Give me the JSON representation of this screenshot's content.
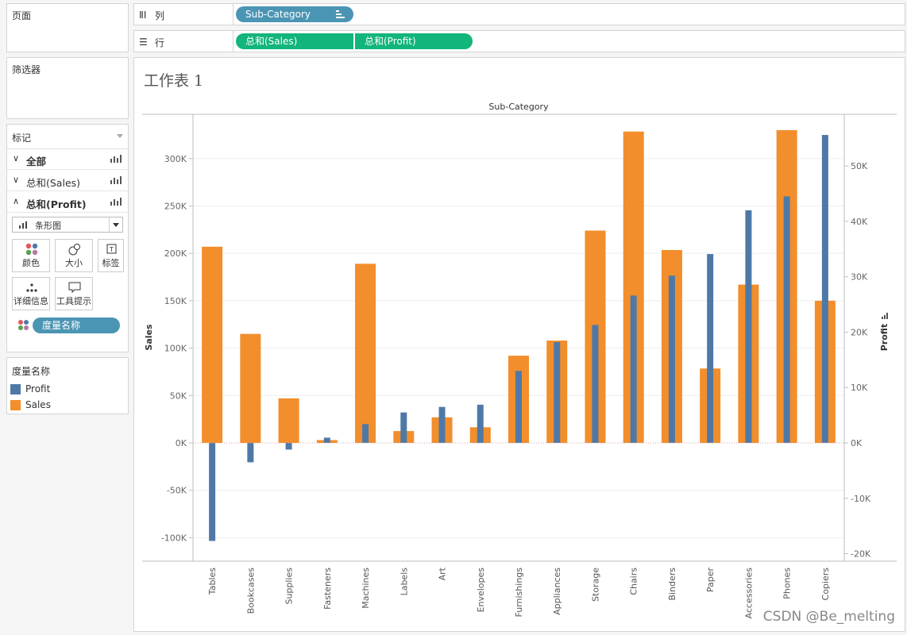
{
  "sidebar": {
    "pages_title": "页面",
    "filters_title": "筛选器",
    "marks": {
      "title": "标记",
      "rows": [
        {
          "label": "全部",
          "state": "collapsed"
        },
        {
          "label": "总和(Sales)",
          "state": "collapsed"
        },
        {
          "label": "总和(Profit)",
          "state": "expanded"
        }
      ],
      "mark_type": "条形图",
      "buttons": {
        "color": "颜色",
        "size": "大小",
        "label": "标签",
        "detail": "详细信息",
        "tooltip": "工具提示"
      },
      "color_pill": "度量名称"
    },
    "legend": {
      "title": "度量名称",
      "items": [
        {
          "name": "Profit",
          "color": "#4e79a7"
        },
        {
          "name": "Sales",
          "color": "#f28e2b"
        }
      ]
    }
  },
  "shelves": {
    "columns": {
      "label": "列",
      "pills": [
        "Sub-Category"
      ]
    },
    "rows": {
      "label": "行",
      "pills": [
        "总和(Sales)",
        "总和(Profit)"
      ]
    }
  },
  "sheet": {
    "title": "工作表 1"
  },
  "chart_data": {
    "type": "bar",
    "title": "Sub-Category",
    "categories": [
      "Tables",
      "Bookcases",
      "Supplies",
      "Fasteners",
      "Machines",
      "Labels",
      "Art",
      "Envelopes",
      "Furnishings",
      "Appliances",
      "Storage",
      "Chairs",
      "Binders",
      "Paper",
      "Accessories",
      "Phones",
      "Copiers"
    ],
    "series": [
      {
        "name": "Sales",
        "axis": "left",
        "color": "#f28e2b",
        "values": [
          207000,
          115000,
          47000,
          3000,
          189000,
          12500,
          27000,
          16500,
          92000,
          108000,
          224000,
          328500,
          203500,
          78500,
          167000,
          330000,
          150000
        ]
      },
      {
        "name": "Profit",
        "axis": "right",
        "color": "#4e79a7",
        "values": [
          -17700,
          -3500,
          -1200,
          950,
          3400,
          5500,
          6500,
          6900,
          13000,
          18200,
          21300,
          26600,
          30200,
          34100,
          42000,
          44500,
          55600
        ]
      }
    ],
    "ylabel": "Sales",
    "y2label": "Profit",
    "ylim": [
      -125000,
      350000
    ],
    "y2lim": [
      -21000,
      58000
    ],
    "yticks": [
      -100000,
      -50000,
      0,
      50000,
      100000,
      150000,
      200000,
      250000,
      300000
    ],
    "ytick_labels": [
      "-100K",
      "-50K",
      "0K",
      "50K",
      "100K",
      "150K",
      "200K",
      "250K",
      "300K"
    ],
    "y2ticks": [
      -20000,
      -10000,
      0,
      10000,
      20000,
      30000,
      40000,
      50000
    ],
    "y2tick_labels": [
      "-20K",
      "-10K",
      "0K",
      "10K",
      "20K",
      "30K",
      "40K",
      "50K"
    ],
    "grid": true
  },
  "watermark": "CSDN @Be_melting"
}
